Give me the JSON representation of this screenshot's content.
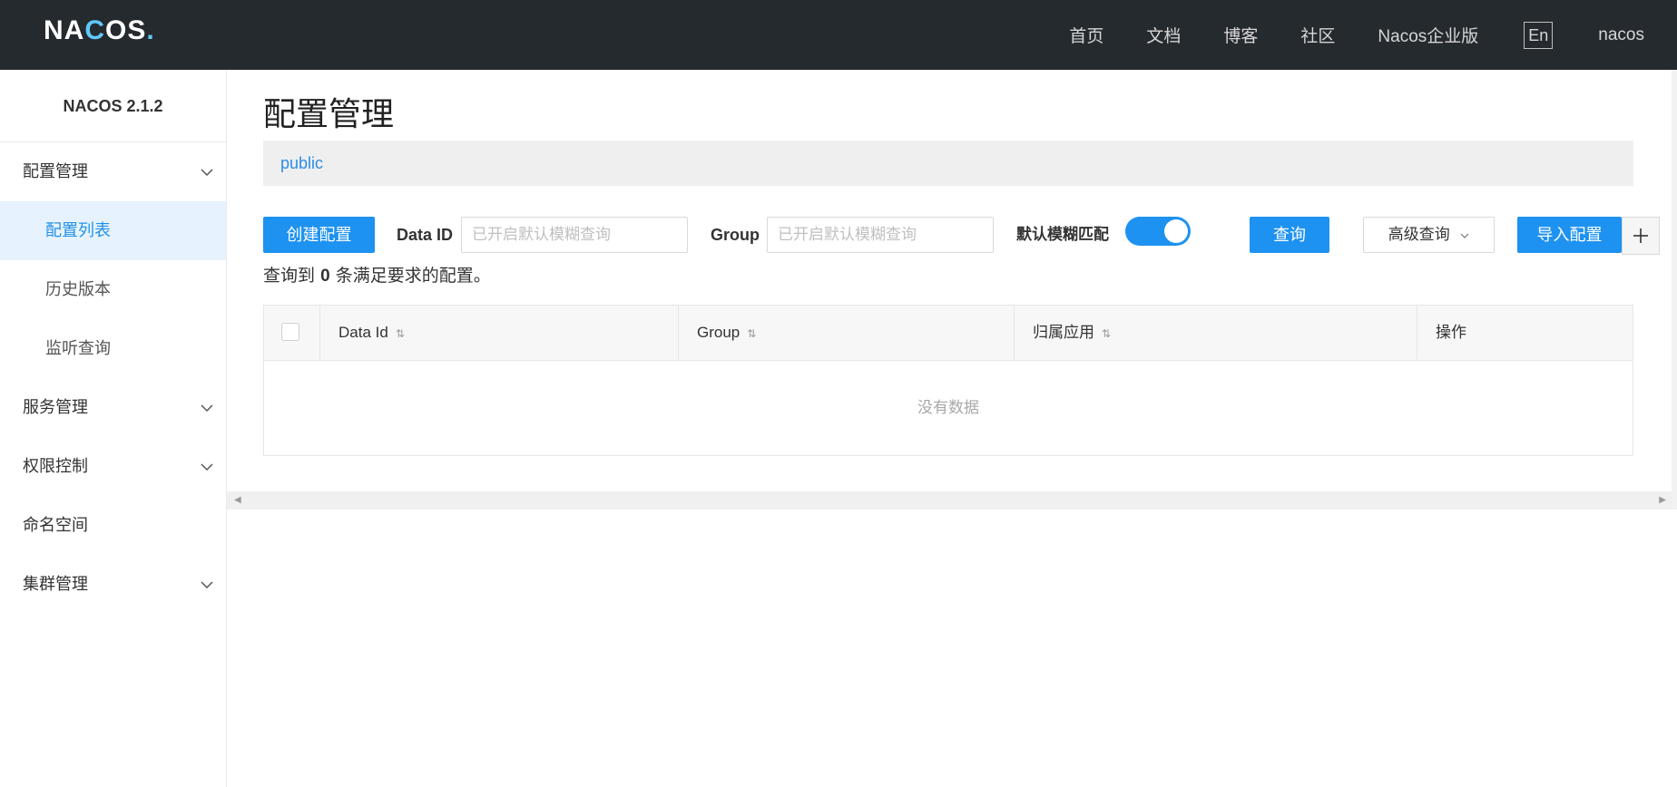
{
  "header": {
    "logo": {
      "part1": "NA",
      "part2": "C",
      "part3": "OS",
      "dot": "."
    },
    "nav": [
      "首页",
      "文档",
      "博客",
      "社区",
      "Nacos企业版"
    ],
    "lang": "En",
    "user": "nacos"
  },
  "sidebar": {
    "version": "NACOS 2.1.2",
    "groups": [
      {
        "label": "配置管理",
        "icon": "chevron-down-icon"
      },
      {
        "label": "服务管理",
        "icon": "chevron-down-icon"
      },
      {
        "label": "权限控制",
        "icon": "chevron-down-icon"
      },
      {
        "label": "命名空间"
      },
      {
        "label": "集群管理",
        "icon": "chevron-down-icon"
      }
    ],
    "config_items": [
      "配置列表",
      "历史版本",
      "监听查询"
    ]
  },
  "main": {
    "title": "配置管理",
    "namespace": "public",
    "toolbar": {
      "create_label": "创建配置",
      "data_id_label": "Data ID",
      "data_id_placeholder": "已开启默认模糊查询",
      "group_label": "Group",
      "group_placeholder": "已开启默认模糊查询",
      "fuzzy_label": "默认模糊匹配",
      "fuzzy_on": true,
      "query_label": "查询",
      "advanced_label": "高级查询",
      "import_label": "导入配置"
    },
    "result": {
      "prefix": "查询到",
      "count": "0",
      "suffix": "条满足要求的配置。"
    },
    "table": {
      "columns": [
        "Data Id",
        "Group",
        "归属应用",
        "操作"
      ],
      "empty_text": "没有数据"
    }
  },
  "colors": {
    "primary": "#1e92f0",
    "header_bg": "#252a2f",
    "active_menu_bg": "#e6f3fe"
  }
}
